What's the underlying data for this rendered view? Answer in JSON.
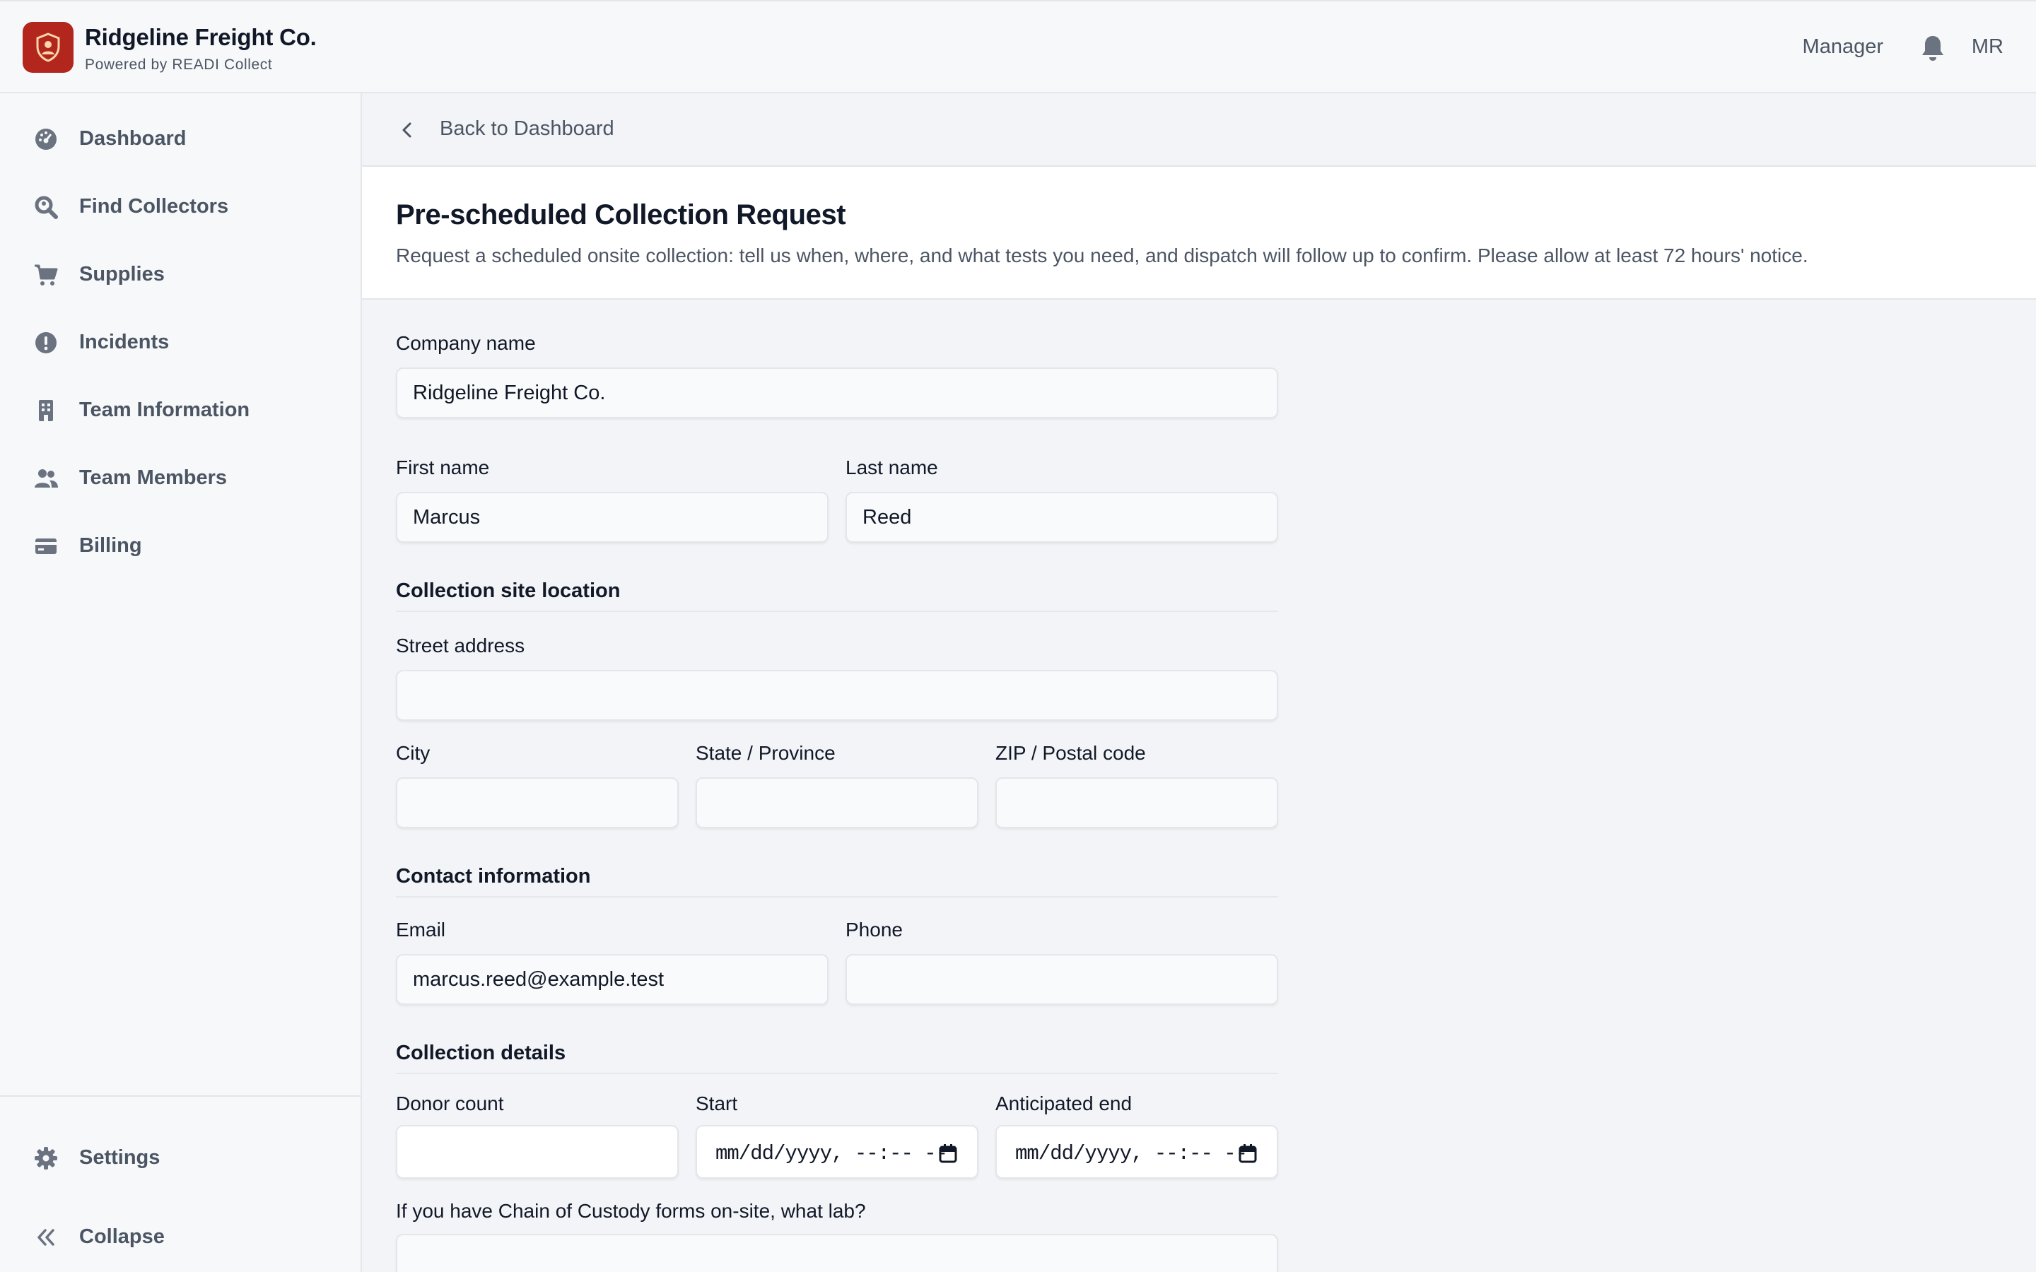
{
  "header": {
    "brand_name": "Ridgeline Freight Co.",
    "brand_sub": "Powered by READI Collect",
    "role": "Manager",
    "avatar_initials": "MR",
    "brand_color": "#b3261e"
  },
  "sidebar": {
    "items": [
      {
        "label": "Dashboard",
        "icon": "gauge-icon"
      },
      {
        "label": "Find Collectors",
        "icon": "search-icon"
      },
      {
        "label": "Supplies",
        "icon": "cart-icon"
      },
      {
        "label": "Incidents",
        "icon": "alert-icon"
      },
      {
        "label": "Team Information",
        "icon": "building-icon"
      },
      {
        "label": "Team Members",
        "icon": "users-icon"
      },
      {
        "label": "Billing",
        "icon": "card-icon"
      }
    ],
    "footer": [
      {
        "label": "Settings",
        "icon": "gear-icon"
      },
      {
        "label": "Collapse",
        "icon": "double-chevron-left-icon"
      }
    ]
  },
  "main": {
    "back_label": "Back to Dashboard",
    "title": "Pre-scheduled Collection Request",
    "description": "Request a scheduled onsite collection: tell us when, where, and what tests you need, and dispatch will follow up to confirm. Please allow at least 72 hours' notice.",
    "form": {
      "company_name": {
        "label": "Company name",
        "value": "Ridgeline Freight Co."
      },
      "first_name": {
        "label": "First name",
        "value": "Marcus"
      },
      "last_name": {
        "label": "Last name",
        "value": "Reed"
      },
      "location_section": "Collection site location",
      "street": {
        "label": "Street address",
        "value": ""
      },
      "city": {
        "label": "City",
        "value": ""
      },
      "state": {
        "label": "State / Province",
        "value": ""
      },
      "zip": {
        "label": "ZIP / Postal code",
        "value": ""
      },
      "contact_section": "Contact information",
      "email": {
        "label": "Email",
        "value": "marcus.reed@example.test"
      },
      "phone": {
        "label": "Phone",
        "value": ""
      },
      "details_section": "Collection details",
      "donor_count": {
        "label": "Donor count",
        "value": ""
      },
      "start": {
        "label": "Start",
        "placeholder": "mm/dd/yyyy, --:-- --"
      },
      "end": {
        "label": "Anticipated end",
        "placeholder": "mm/dd/yyyy, --:-- --"
      },
      "coc_lab": {
        "label": "If you have Chain of Custody forms on-site, what lab?",
        "value": ""
      }
    }
  }
}
